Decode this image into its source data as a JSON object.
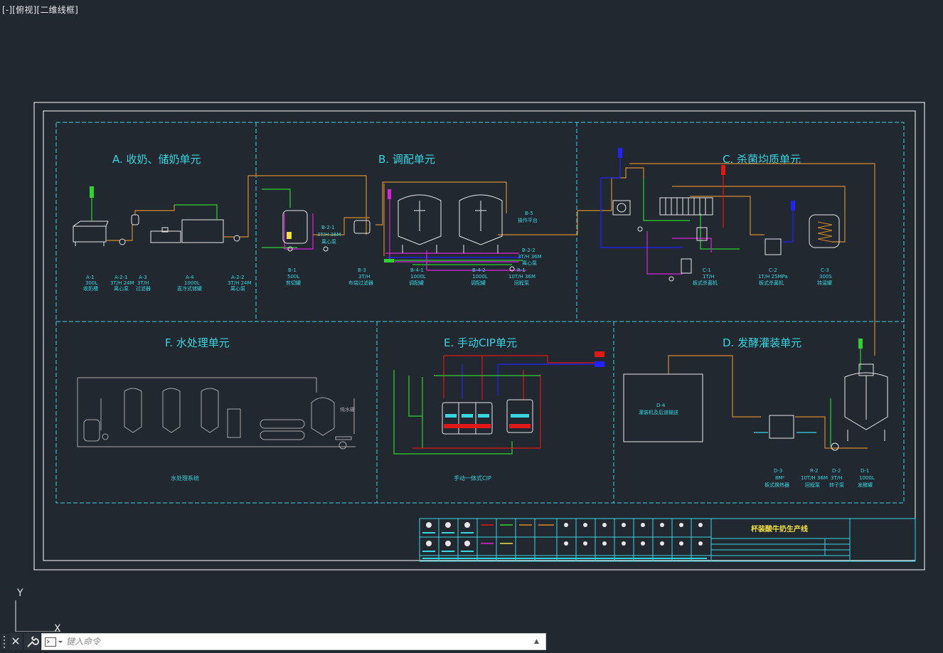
{
  "viewport": {
    "label": "[-][俯视][二维线框]"
  },
  "colors": {
    "background": "#212830",
    "cyan": "#36d6e0",
    "frame": "#ffffff",
    "orange": "#d38a2c",
    "green": "#2fd32f",
    "blue": "#2222ff",
    "magenta": "#e020e0",
    "red": "#e01818",
    "yellow": "#f0e040"
  },
  "drawing": {
    "sections": {
      "a": {
        "title": "A. 收奶、储奶单元"
      },
      "b": {
        "title": "B. 调配单元"
      },
      "c": {
        "title": "C. 杀菌均质单元"
      },
      "d": {
        "title": "D. 发酵灌装单元"
      },
      "e": {
        "title": "E. 手动CIP单元"
      },
      "f": {
        "title": "F. 水处理单元"
      }
    },
    "labels_a": [
      {
        "code": "A-1",
        "l2": "300L",
        "l3": "收奶槽"
      },
      {
        "code": "A-2-1",
        "l2": "3T/H 24M",
        "l3": "离心泵"
      },
      {
        "code": "A-3",
        "l2": "3T/H",
        "l3": "过滤器"
      },
      {
        "code": "A-4",
        "l2": "1000L",
        "l3": "直冷式储罐"
      },
      {
        "code": "A-2-2",
        "l2": "3T/H 24M",
        "l3": "离心泵"
      }
    ],
    "labels_b": [
      {
        "code": "B-1",
        "l2": "500L",
        "l3": "剪切罐"
      },
      {
        "code": "B-3",
        "l2": "3T/H",
        "l3": "布袋过滤器"
      },
      {
        "code": "B-4-1",
        "l2": "1000L",
        "l3": "调配罐"
      },
      {
        "code": "B-4-2",
        "l2": "1000L",
        "l3": "调配罐"
      },
      {
        "code": "R-1",
        "l2": "10T/H 36M",
        "l3": "回程泵"
      }
    ],
    "label_b21": {
      "code": "B-2-1",
      "l2": "3T/H 36M",
      "l3": "离心泵"
    },
    "label_b22": {
      "code": "B-2-2",
      "l2": "3T/H 36M",
      "l3": "离心泵"
    },
    "label_b5": {
      "code": "B-5",
      "l2": "操作平台"
    },
    "labels_c": [
      {
        "code": "C-1",
        "l2": "1T/H",
        "l3": "板式杀菌机"
      },
      {
        "code": "C-2",
        "l2": "1T/H 25MPa",
        "l3": "板式杀菌机"
      },
      {
        "code": "C-3",
        "l2": "300S",
        "l3": "持温罐"
      }
    ],
    "labels_d": [
      {
        "code": "D-3",
        "l2": "8M²",
        "l3": "板式换热器"
      },
      {
        "code": "R-2",
        "l2": "10T/H 36M",
        "l3": "回程泵"
      },
      {
        "code": "D-2",
        "l2": "3T/H",
        "l3": "转子泵"
      },
      {
        "code": "D-1",
        "l2": "1000L",
        "l3": "发酵罐"
      }
    ],
    "label_d4": {
      "code": "D-4",
      "l2": "灌装机及后道输送"
    },
    "label_f": "水处理系统",
    "label_e": "手动一体式CIP",
    "label_water": "纯水罐",
    "title_block": {
      "title": "杯装酸牛奶生产线"
    }
  },
  "command_line": {
    "close": "✕",
    "placeholder": "键入命令"
  },
  "ucs": {
    "y": "Y",
    "x": "X"
  }
}
